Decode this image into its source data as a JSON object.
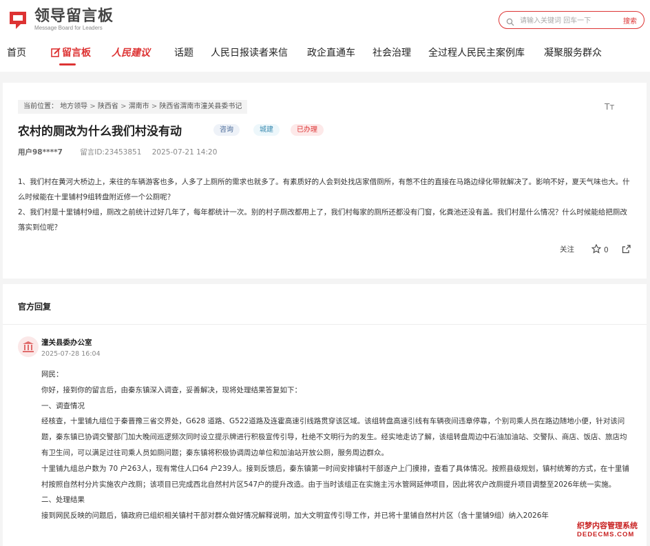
{
  "header": {
    "logo_title": "领导留言板",
    "logo_subtitle": "Message Board for Leaders",
    "search_placeholder": "请输入关键词 回车一下",
    "search_button": "搜索"
  },
  "nav": {
    "items": [
      "首页",
      "留言板",
      "人民建议",
      "话题",
      "人民日报读者来信",
      "政企直通车",
      "社会治理",
      "全过程人民民主案例库",
      "凝聚服务群众"
    ],
    "active_index": 1
  },
  "message": {
    "breadcrumb": [
      "当前位置：",
      "地方领导",
      "陕西省",
      "渭南市",
      "陕西省渭南市潼关县委书记"
    ],
    "font_toggle": "Tт",
    "title": "农村的厕改为什么我们村没有动",
    "tags": [
      "咨询",
      "城建",
      "已办理"
    ],
    "user": "用户98****7",
    "message_id": "留言ID:23453851",
    "date": "2025-07-21 14:20",
    "paragraphs": [
      "1、我们村在黄河大桥边上，来往的车辆游客也多，人多了上厕所的需求也就多了。有素质好的人会到处找店家借厕所，有憋不住的直接在马路边绿化带就解决了。影响不好，夏天气味也大。什么时候能在十里铺村9组转盘附近修一个公厕呢？",
      "2、我们村是十里铺村9组，厕改之前统计过好几年了，每年都统计一次。别的村子厕改都用上了，我们村每家的厕所还都没有门窗，化粪池还没有盖。我们村是什么情况？什么时候能给把厕改落实到位呢？"
    ],
    "follow_label": "关注",
    "like_count": "0"
  },
  "reply": {
    "section_title": "官方回复",
    "org_name": "潼关县委办公室",
    "date": "2025-07-28 16:04",
    "paragraphs": [
      "网民：",
      "你好，接到你的留言后，由秦东镇深入调查，妥善解决，现将处理结果答复如下：",
      "一、调查情况",
      "经核查，十里铺九组位于秦晋豫三省交界处，G628 道路、G522道路及连霍高速引线路贯穿该区域。该组转盘高速引线有车辆夜间违章停靠，个别司乘人员在路边随地小便，针对该问题，秦东镇已协调交警部门加大晚间巡逻频次同时设立提示牌进行积极宣传引导，杜绝不文明行为的发生。经实地走访了解，该组转盘周边中石油加油站、交警队、商店、饭店、旅店均有卫生间，可以满足过往司乘人员如厕问题；秦东镇将积极协调周边单位和加油站开放公厕，服务周边群众。",
      "十里铺九组总户数为 70 户263人，现有常住人口64 户239人。接到反馈后，秦东镇第一时间安排镇村干部逐户上门摸排，查看了具体情况。按照县级规划，镇村统筹的方式，在十里铺村按照自然村分片实施农户改厕；该项目已完成西北自然村片区547户的提升改造。由于当时该组正在实施主污水管网延伸项目，因此将农户改厕提升项目调整至2026年统一实施。",
      "二、处理结果",
      "接到网民反映的问题后，镇政府已组织相关镇村干部对群众做好情况解释说明，加大文明宣传引导工作，并已将十里铺自然村片区（含十里铺9组）纳入2026年"
    ]
  },
  "watermark": {
    "line1": "织梦内容管理系统",
    "line2": "DEDECMS.COM"
  },
  "colors": {
    "accent": "#d33333",
    "page_bg": "#f4f4f4"
  }
}
